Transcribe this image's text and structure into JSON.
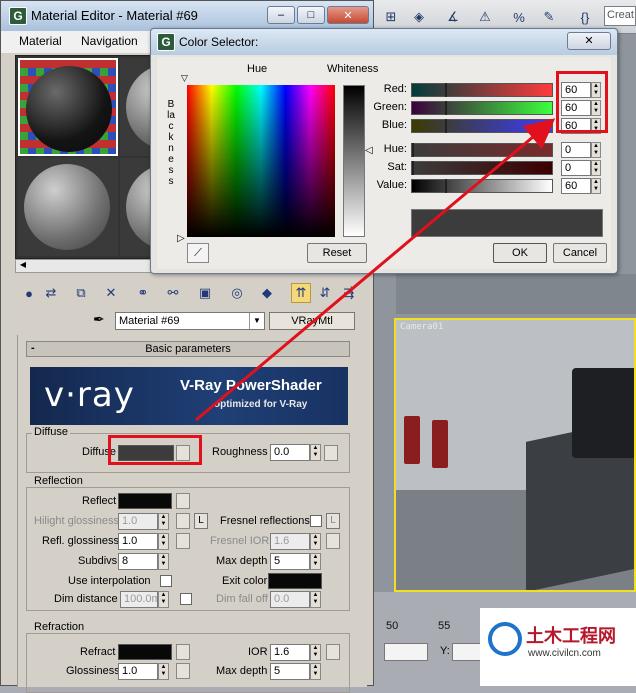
{
  "material_editor": {
    "title": "Material Editor - Material #69",
    "menu": [
      "Material",
      "Navigation"
    ],
    "material_name": "Material #69",
    "material_type": "VRayMtl",
    "rollout_title": "Basic parameters",
    "rollout_toggle": "-",
    "banner": {
      "logo": "v·ray",
      "title": "V-Ray PowerShader",
      "subtitle": "optimized for V-Ray"
    },
    "diffuse": {
      "group_label": "Diffuse",
      "diffuse_label": "Diffuse",
      "diffuse_color": "#3c3c3c",
      "roughness_label": "Roughness",
      "roughness_value": "0.0"
    },
    "reflection": {
      "group_label": "Reflection",
      "reflect_label": "Reflect",
      "hilight_label": "Hilight glossiness",
      "hilight_value": "1.0",
      "lock_label": "L",
      "fresnel_label": "Fresnel reflections",
      "refl_gloss_label": "Refl. glossiness",
      "refl_gloss_value": "1.0",
      "fresnel_ior_label": "Fresnel IOR",
      "fresnel_ior_value": "1.6",
      "subdivs_label": "Subdivs",
      "subdivs_value": "8",
      "max_depth_label": "Max depth",
      "max_depth_value": "5",
      "use_interp_label": "Use interpolation",
      "exit_color_label": "Exit color",
      "dim_distance_label": "Dim distance",
      "dim_distance_value": "100.0m",
      "dim_falloff_label": "Dim fall off",
      "dim_falloff_value": "0.0"
    },
    "refraction": {
      "group_label": "Refraction",
      "refract_label": "Refract",
      "ior_label": "IOR",
      "ior_value": "1.6",
      "glossiness_label": "Glossiness",
      "glossiness_value": "1.0",
      "max_depth_label": "Max depth",
      "max_depth_value": "5"
    }
  },
  "color_selector": {
    "title": "Color Selector:",
    "hue_label": "Hue",
    "whiteness_label": "Whiteness",
    "blackness_label": "Blackness",
    "channels": [
      {
        "label": "Red:",
        "value": "60"
      },
      {
        "label": "Green:",
        "value": "60"
      },
      {
        "label": "Blue:",
        "value": "60"
      },
      {
        "label": "Hue:",
        "value": "0"
      },
      {
        "label": "Sat:",
        "value": "0"
      },
      {
        "label": "Value:",
        "value": "60"
      }
    ],
    "reset_label": "Reset",
    "ok_label": "OK",
    "cancel_label": "Cancel",
    "preview_color": "#3c3c3c"
  },
  "viewport": {
    "camera_label": "Camera01",
    "create_label": "Creat",
    "timeline_ticks": [
      "50",
      "55"
    ],
    "y_label": "Y:"
  },
  "watermark": {
    "title": "土木工程网",
    "url": "www.civilcn.com"
  },
  "colors": {
    "highlight": "#e0101c",
    "viewport_border": "#f0e020"
  }
}
